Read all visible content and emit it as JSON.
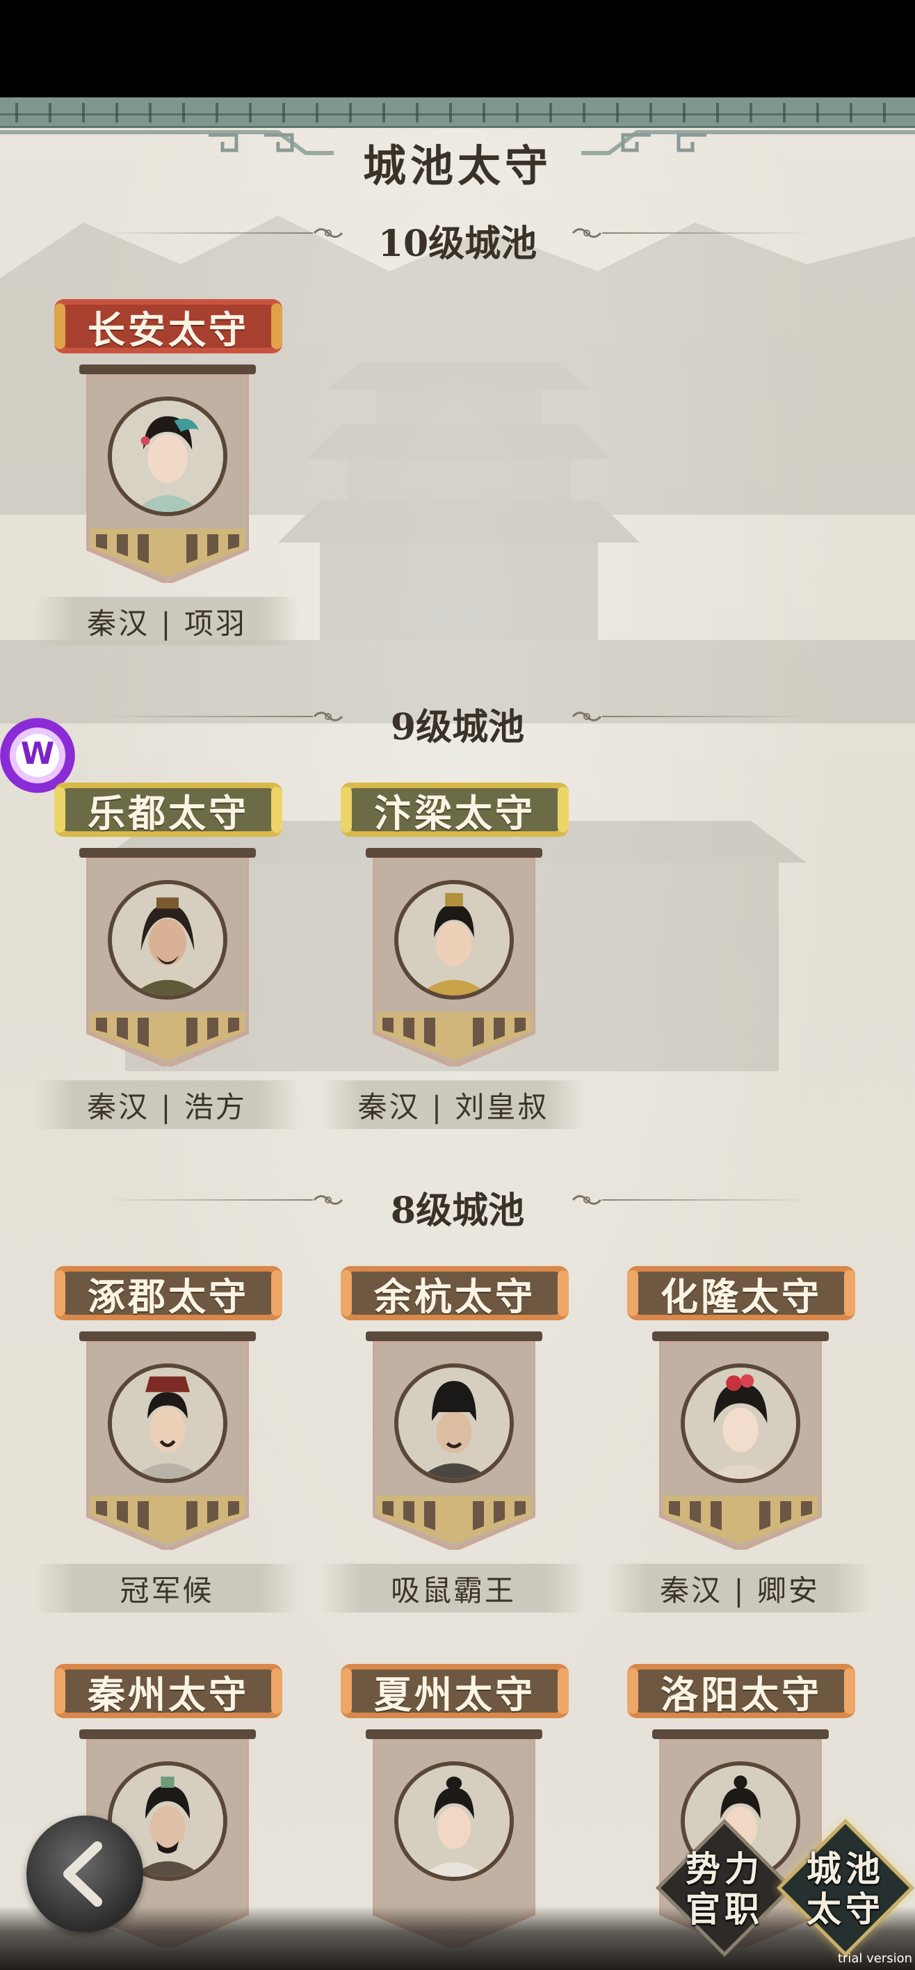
{
  "page": {
    "title": "城池太守",
    "watermark": "trial version"
  },
  "sections": [
    {
      "label": "10级城池",
      "cards": [
        {
          "title": "长安太守",
          "name": "秦汉 | 项羽",
          "plate": "red",
          "portrait": "lady-teal-headdress"
        }
      ]
    },
    {
      "label": "9级城池",
      "cards": [
        {
          "title": "乐都太守",
          "name": "秦汉 | 浩方",
          "plate": "gold",
          "portrait": "bearded-warrior"
        },
        {
          "title": "汴梁太守",
          "name": "秦汉 | 刘皇叔",
          "plate": "gold",
          "portrait": "young-lord"
        }
      ]
    },
    {
      "label": "8级城池",
      "cards": [
        {
          "title": "涿郡太守",
          "name": "冠军候",
          "plate": "brown",
          "portrait": "crowned-general"
        },
        {
          "title": "余杭太守",
          "name": "吸鼠霸王",
          "plate": "brown",
          "portrait": "black-cap-man"
        },
        {
          "title": "化隆太守",
          "name": "秦汉 | 卿安",
          "plate": "brown",
          "portrait": "lady-red-flower"
        },
        {
          "title": "秦州太守",
          "name": "",
          "plate": "brown",
          "portrait": "mustached-official"
        },
        {
          "title": "夏州太守",
          "name": "",
          "plate": "brown",
          "portrait": "young-scholar"
        },
        {
          "title": "洛阳太守",
          "name": "",
          "plate": "brown",
          "portrait": "topknot-youth"
        }
      ]
    }
  ],
  "nav": {
    "power_ranks": "势力官职",
    "city_governors": "城池太守",
    "back": "back-arrow-icon"
  },
  "badge": "W",
  "colors": {
    "background": "#e6e2d8",
    "plate_red": "#c9533e",
    "plate_gold": "#d8b94a",
    "plate_brown": "#d8884a",
    "text_dark": "#3a3229"
  }
}
